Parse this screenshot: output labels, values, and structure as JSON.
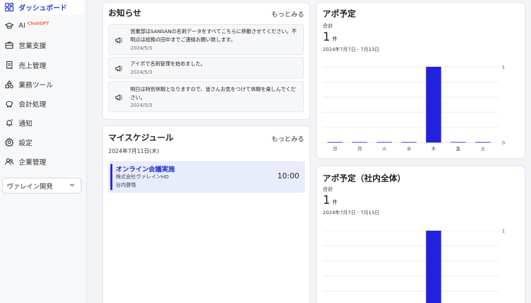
{
  "sidebar": {
    "items": [
      {
        "label": "ダッシュボード",
        "icon": "dashboard-icon",
        "active": true
      },
      {
        "label": "AI",
        "icon": "graduation-cap-icon",
        "badge": "ChatGPT"
      },
      {
        "label": "営業支援",
        "icon": "briefcase-icon"
      },
      {
        "label": "売上管理",
        "icon": "receipt-icon"
      },
      {
        "label": "業務ツール",
        "icon": "shapes-icon"
      },
      {
        "label": "会計処理",
        "icon": "piggy-bank-icon"
      },
      {
        "label": "通知",
        "icon": "bell-icon"
      },
      {
        "label": "設定",
        "icon": "gear-icon"
      },
      {
        "label": "企業管理",
        "icon": "users-icon"
      }
    ],
    "company_select": {
      "value": "ヴァレイン開発"
    }
  },
  "notices": {
    "title": "お知らせ",
    "more": "もっとみる",
    "items": [
      {
        "text": "営業部はSANSANの名刺データをすべてこちらに移動させてください。不明点は総務の田中までご連絡お願い致します。",
        "date": "2024/5/3"
      },
      {
        "text": "アイポで名刺管理を始めました。",
        "date": "2024/5/3"
      },
      {
        "text": "明日は特別休暇となりますので、皆さんお気をつけて休暇を楽しんでください。",
        "date": "2024/5/3"
      }
    ]
  },
  "schedule": {
    "title": "マイスケジュール",
    "more": "もっとみる",
    "date": "2024年7月11日(木)",
    "events": [
      {
        "title": "オンライン会議実施",
        "company": "株式会社ヴァレインHD",
        "person": "谷内健悟",
        "time": "10:00"
      }
    ]
  },
  "appo": {
    "title": "アポ予定",
    "total_label": "合計",
    "total": "1",
    "unit": "件",
    "range": "2024年7月7日 - 7月13日"
  },
  "appo_all": {
    "title": "アポ予定（社内全体）",
    "total_label": "合計",
    "total": "1",
    "unit": "件",
    "range": "2024年7月7日 - 7月13日"
  },
  "chart_data": [
    {
      "type": "bar",
      "categories": [
        "日",
        "月",
        "火",
        "水",
        "木",
        "金",
        "土"
      ],
      "values": [
        0,
        0,
        0,
        0,
        1,
        0,
        0
      ],
      "ylim": [
        0,
        1
      ],
      "yticks": [
        "0",
        "1"
      ],
      "grid": true,
      "color": "#2222dd"
    },
    {
      "type": "bar",
      "values": [
        0,
        0,
        0,
        0,
        1,
        0,
        0
      ],
      "ylim": [
        0,
        1
      ],
      "yticks": [
        "1"
      ],
      "grid": true,
      "color": "#2222dd"
    }
  ]
}
